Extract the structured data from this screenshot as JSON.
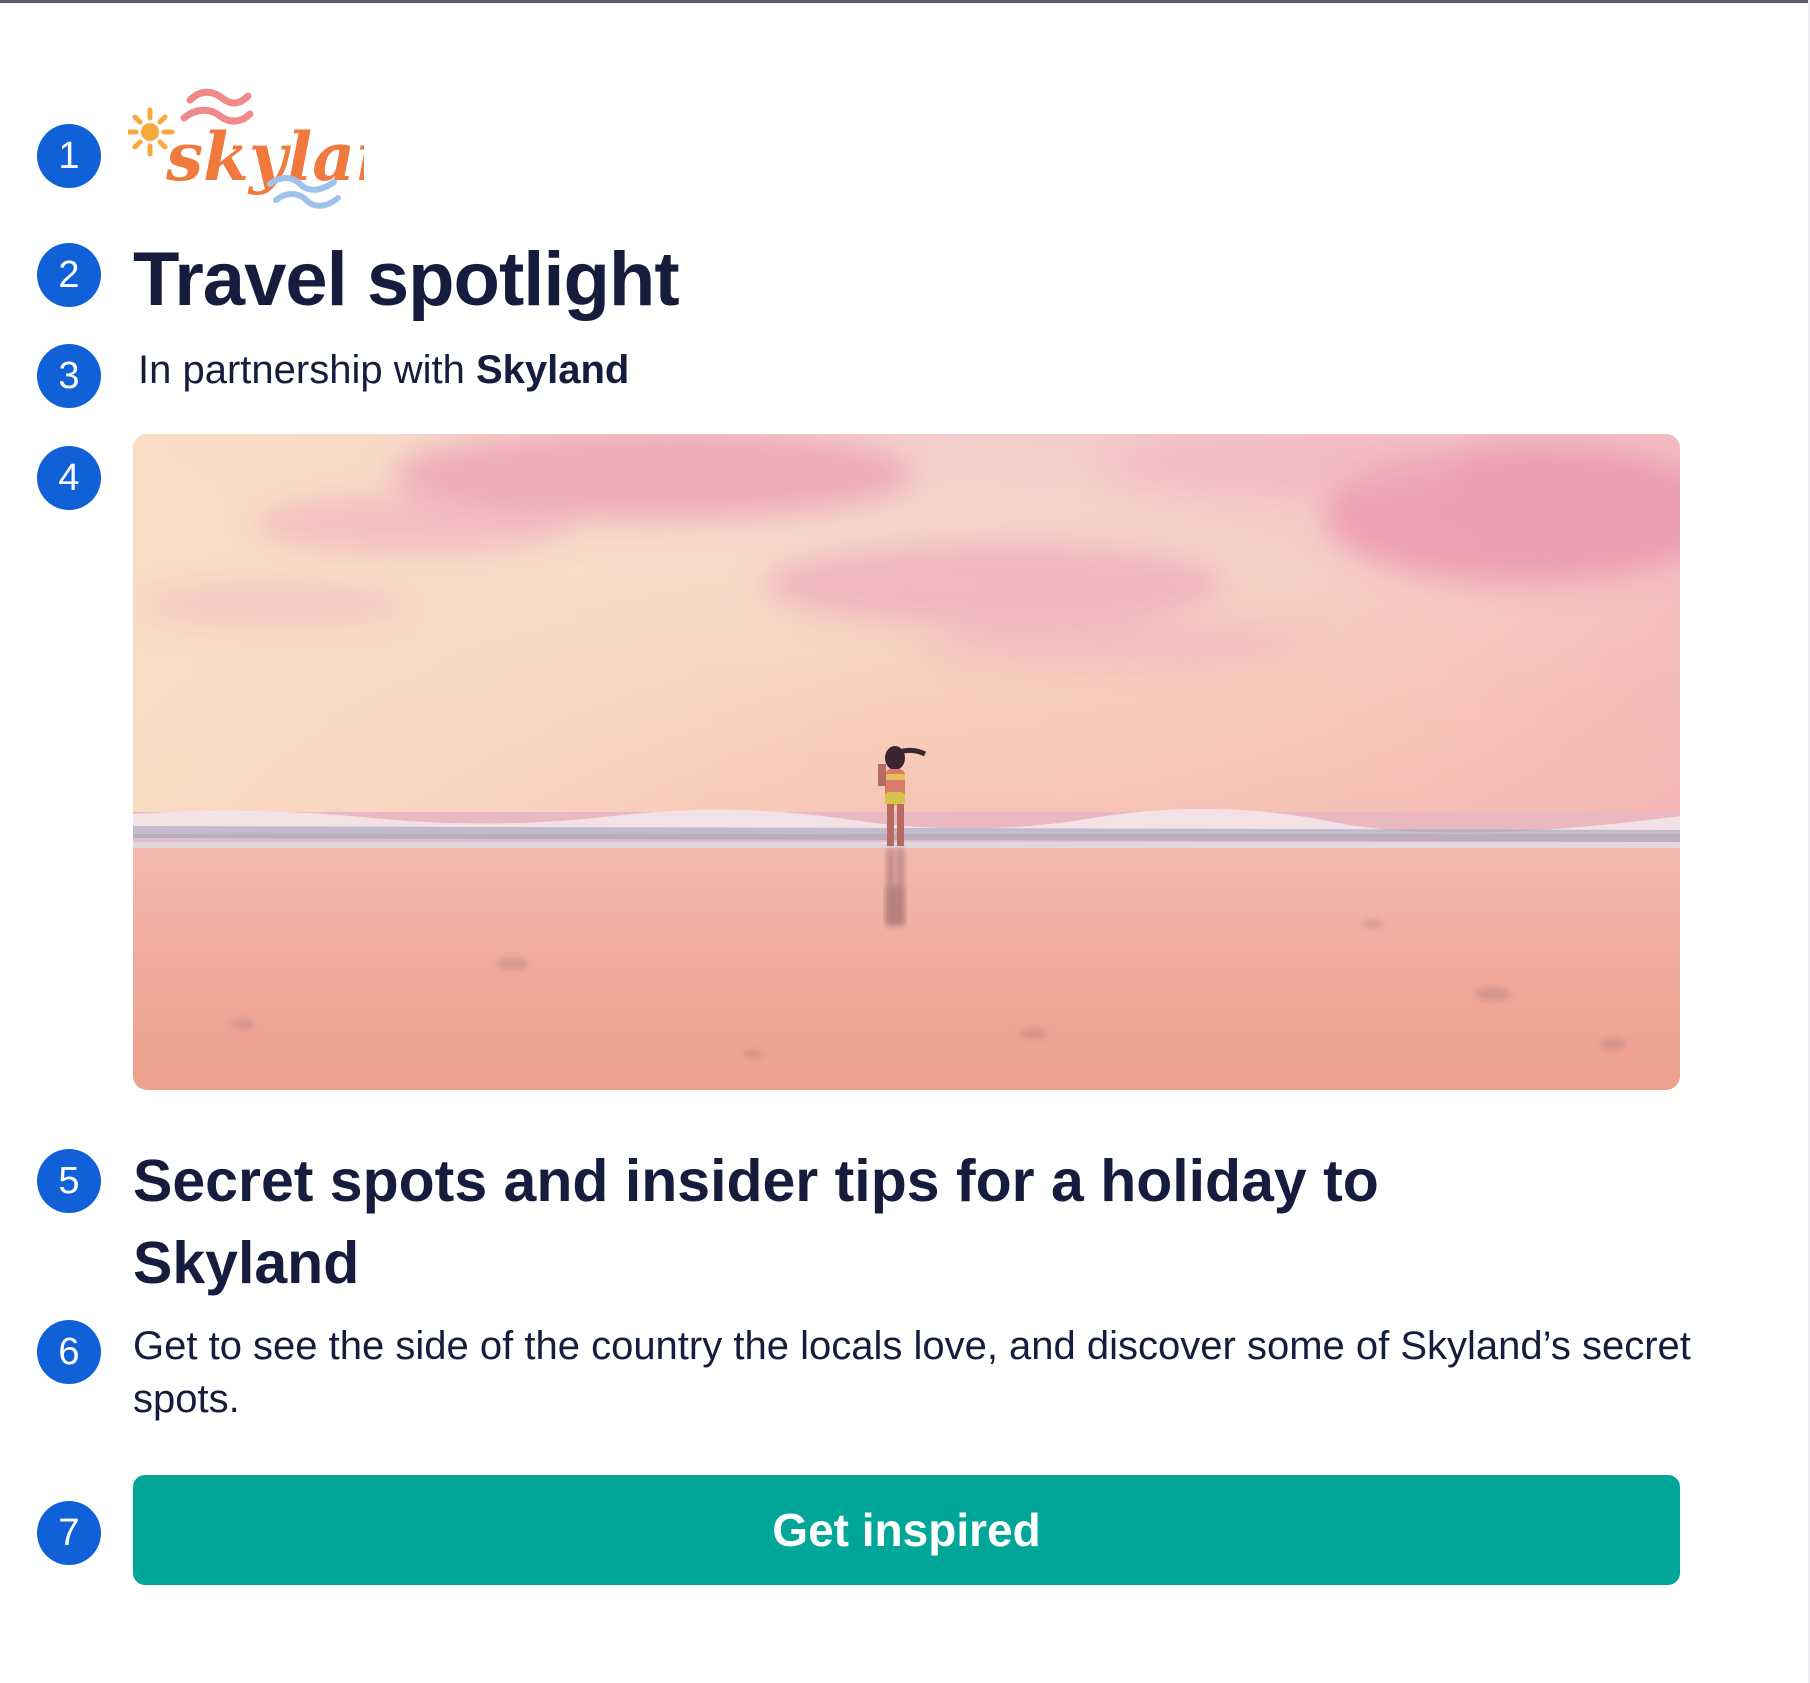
{
  "brand": {
    "logo_text": "skyland",
    "name": "Skyland"
  },
  "markers": [
    "1",
    "2",
    "3",
    "4",
    "5",
    "6",
    "7"
  ],
  "spotlight": {
    "title": "Travel spotlight",
    "partnership_prefix": "In partnership with",
    "partner_name": "Skyland"
  },
  "hero_image": {
    "description": "Woman standing at the water's edge on a beach under a pink sunset sky"
  },
  "article": {
    "headline": "Secret spots and insider tips for a holiday to Skyland",
    "description": "Get to see the side of the country the locals love, and discover some of Skyland’s secret spots."
  },
  "cta": {
    "label": "Get inspired"
  },
  "colors": {
    "marker": "#1060d8",
    "text": "#161c3d",
    "button": "#00a698",
    "logo_orange": "#f07a3e",
    "logo_blue": "#9ec2ea"
  }
}
